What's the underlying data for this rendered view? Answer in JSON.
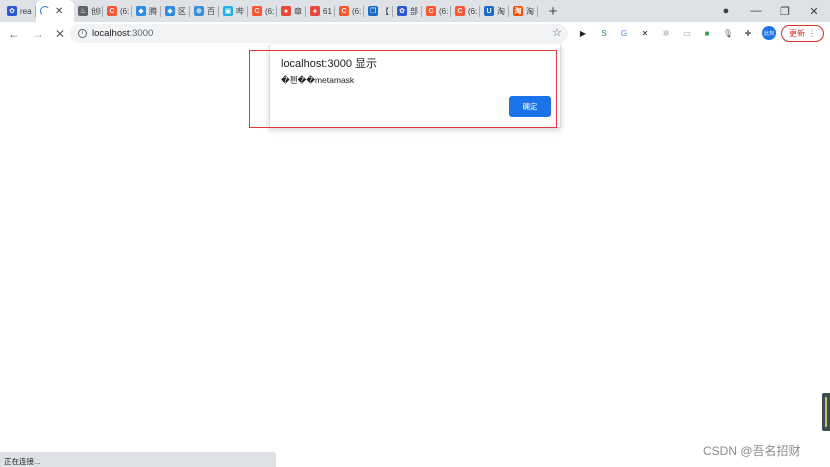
{
  "tabs": [
    {
      "title": "rea",
      "icon": "paw-icon",
      "color": "#2b57d6",
      "glyph": "✿"
    },
    {
      "title": "",
      "icon": "loading-spinner-icon",
      "color": "#1a73e8",
      "glyph": "",
      "active": true
    },
    {
      "title": "创l",
      "icon": "flask-icon",
      "color": "#5f6368",
      "glyph": "♨"
    },
    {
      "title": "(6:",
      "icon": "csdn-icon",
      "color": "#fc5531",
      "glyph": "C"
    },
    {
      "title": "腾",
      "icon": "tencent-cloud-icon",
      "color": "#2f8ae3",
      "glyph": "◆"
    },
    {
      "title": "区",
      "icon": "tencent-cloud-icon",
      "color": "#2f8ae3",
      "glyph": "◆"
    },
    {
      "title": "百",
      "icon": "globe-icon",
      "color": "#3b8fd8",
      "glyph": "⊕"
    },
    {
      "title": "哔",
      "icon": "bilibili-icon",
      "color": "#23ade5",
      "glyph": "▣"
    },
    {
      "title": "(6:",
      "icon": "csdn-icon",
      "color": "#fc5531",
      "glyph": "C"
    },
    {
      "title": "章",
      "icon": "flame-icon",
      "color": "#e8483a",
      "glyph": "♠"
    },
    {
      "title": "61",
      "icon": "flame-icon",
      "color": "#e8483a",
      "glyph": "♠"
    },
    {
      "title": "(6:",
      "icon": "csdn-icon",
      "color": "#fc5531",
      "glyph": "C"
    },
    {
      "title": "【",
      "icon": "puzzle-icon",
      "color": "#1b6ac9",
      "glyph": "❐"
    },
    {
      "title": "部",
      "icon": "paw-icon",
      "color": "#2b57d6",
      "glyph": "✿"
    },
    {
      "title": "(6:",
      "icon": "csdn-icon",
      "color": "#fc5531",
      "glyph": "C"
    },
    {
      "title": "(6:",
      "icon": "csdn-icon",
      "color": "#fc5531",
      "glyph": "C"
    },
    {
      "title": "淘",
      "icon": "u-icon",
      "color": "#1b6ac9",
      "glyph": "U"
    },
    {
      "title": "淘",
      "icon": "taobao-icon",
      "color": "#ff5000",
      "glyph": "淘"
    }
  ],
  "window_controls": {
    "menu": "●",
    "minimize": "—",
    "restore": "❐",
    "close": "✕"
  },
  "toolbar": {
    "back": "←",
    "forward": "→",
    "stop": "✕",
    "info": "i",
    "star": "☆",
    "avatar_label": "此刻",
    "update_label": "更新",
    "update_more": "⋮"
  },
  "address": {
    "host": "localhost",
    "port": ":3000"
  },
  "extensions": [
    {
      "name": "play-extension-icon",
      "glyph": "▶",
      "color": "#202124"
    },
    {
      "name": "s-extension-icon",
      "glyph": "S",
      "color": "#2e8b57"
    },
    {
      "name": "translate-extension-icon",
      "glyph": "G",
      "color": "#4285f4"
    },
    {
      "name": "x-extension-icon",
      "glyph": "✕",
      "color": "#202124"
    },
    {
      "name": "settings-extension-icon",
      "glyph": "✲",
      "color": "#9aa0a6"
    },
    {
      "name": "reader-extension-icon",
      "glyph": "▭",
      "color": "#9aa0a6"
    },
    {
      "name": "color-extension-icon",
      "glyph": "■",
      "color": "#34a853"
    },
    {
      "name": "microphone-extension-icon",
      "glyph": "🎙",
      "color": "#5f6368"
    },
    {
      "name": "puzzle-extension-icon",
      "glyph": "✚",
      "color": "#5f6368"
    }
  ],
  "dialog": {
    "title": "localhost:3000 显示",
    "message": "�펜��metamask",
    "ok": "确定"
  },
  "status_bar": {
    "text": "正在连接..."
  },
  "watermark": {
    "text": "CSDN @吾名招财"
  },
  "colors": {
    "highlight": "#e0393e",
    "accent": "#1a73e8",
    "update": "#d93025"
  }
}
